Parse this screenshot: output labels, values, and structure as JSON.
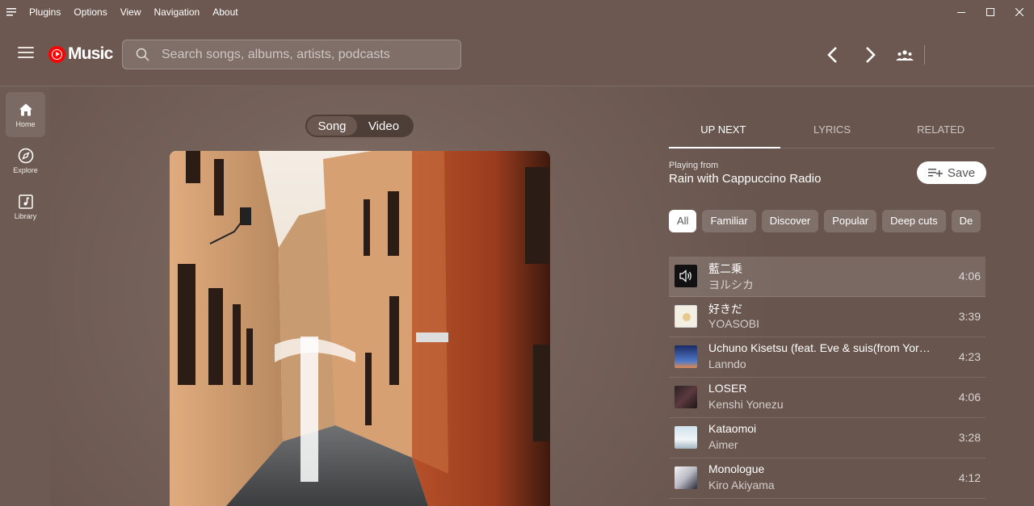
{
  "menubar": {
    "items": [
      "Plugins",
      "Options",
      "View",
      "Navigation",
      "About"
    ]
  },
  "header": {
    "logo_text": "Music",
    "search_placeholder": "Search songs, albums, artists, podcasts"
  },
  "rail": {
    "items": [
      {
        "label": "Home",
        "icon": "home-icon",
        "active": true
      },
      {
        "label": "Explore",
        "icon": "compass-icon",
        "active": false
      },
      {
        "label": "Library",
        "icon": "library-icon",
        "active": false
      }
    ]
  },
  "player": {
    "mode_song": "Song",
    "mode_video": "Video",
    "selected_mode": "Song"
  },
  "side_panel": {
    "tabs": [
      "UP NEXT",
      "LYRICS",
      "RELATED"
    ],
    "active_tab": "UP NEXT",
    "playing_from_label": "Playing from",
    "playlist_name": "Rain with Cappuccino Radio",
    "save_label": "Save",
    "chips": [
      "All",
      "Familiar",
      "Discover",
      "Popular",
      "Deep cuts",
      "De"
    ],
    "active_chip": "All",
    "queue": [
      {
        "title": "藍二乗",
        "artist": "ヨルシカ",
        "duration": "4:06",
        "playing": true
      },
      {
        "title": "好きだ",
        "artist": "YOASOBI",
        "duration": "3:39",
        "playing": false
      },
      {
        "title": "Uchuno Kisetsu (feat. Eve & suis(from Yor…",
        "artist": "Lanndo",
        "duration": "4:23",
        "playing": false
      },
      {
        "title": "LOSER",
        "artist": "Kenshi Yonezu",
        "duration": "4:06",
        "playing": false
      },
      {
        "title": "Kataomoi",
        "artist": "Aimer",
        "duration": "3:28",
        "playing": false
      },
      {
        "title": "Monologue",
        "artist": "Kiro Akiyama",
        "duration": "4:12",
        "playing": false
      }
    ]
  },
  "colors": {
    "background": "#6d5a52",
    "accent_red": "#ff0000",
    "chip_active": "#ffffff"
  }
}
